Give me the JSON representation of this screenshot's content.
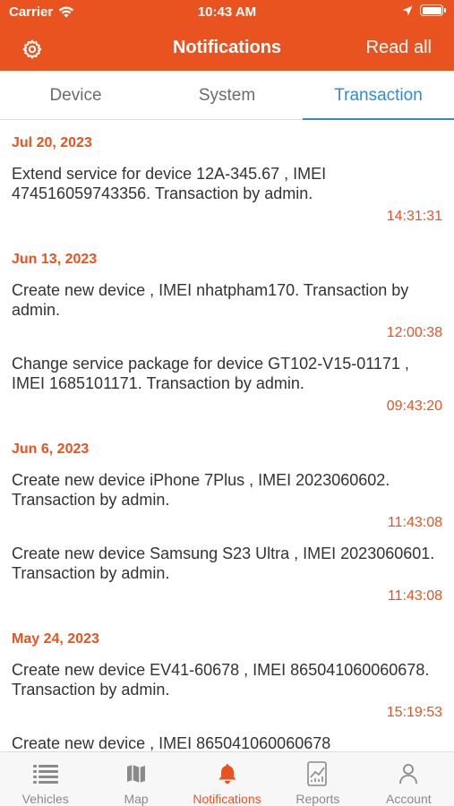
{
  "status_bar": {
    "carrier": "Carrier",
    "time": "10:43 AM"
  },
  "nav": {
    "title": "Notifications",
    "read_all": "Read all"
  },
  "tabs": [
    {
      "label": "Device",
      "active": false
    },
    {
      "label": "System",
      "active": false
    },
    {
      "label": "Transaction",
      "active": true
    }
  ],
  "groups": [
    {
      "date": "Jul 20, 2023",
      "items": [
        {
          "text": "Extend service for device 12A-345.67 , IMEI 474516059743356. Transaction by admin.",
          "time": "14:31:31"
        }
      ]
    },
    {
      "date": "Jun 13, 2023",
      "items": [
        {
          "text": "Create new device  , IMEI nhatpham170. Transaction by admin.",
          "time": "12:00:38"
        },
        {
          "text": "Change service package for device GT102-V15-01171 , IMEI 1685101171. Transaction by admin.",
          "time": "09:43:20"
        }
      ]
    },
    {
      "date": "Jun 6, 2023",
      "items": [
        {
          "text": "Create new device iPhone 7Plus , IMEI 2023060602. Transaction by admin.",
          "time": "11:43:08"
        },
        {
          "text": "Create new device Samsung S23 Ultra , IMEI 2023060601. Transaction by admin.",
          "time": "11:43:08"
        }
      ]
    },
    {
      "date": "May 24, 2023",
      "items": [
        {
          "text": "Create new device EV41-60678 , IMEI 865041060060678. Transaction by admin.",
          "time": "15:19:53"
        },
        {
          "text": "Create new device  , IMEI 865041060060678",
          "time": ""
        }
      ]
    }
  ],
  "tabbar": [
    {
      "label": "Vehicles",
      "icon": "list-icon",
      "active": false
    },
    {
      "label": "Map",
      "icon": "map-icon",
      "active": false
    },
    {
      "label": "Notifications",
      "icon": "bell-icon",
      "active": true
    },
    {
      "label": "Reports",
      "icon": "reports-icon",
      "active": false
    },
    {
      "label": "Account",
      "icon": "person-icon",
      "active": false
    }
  ],
  "colors": {
    "brand": "#e8531f",
    "tab_active": "#2f8bd8"
  }
}
